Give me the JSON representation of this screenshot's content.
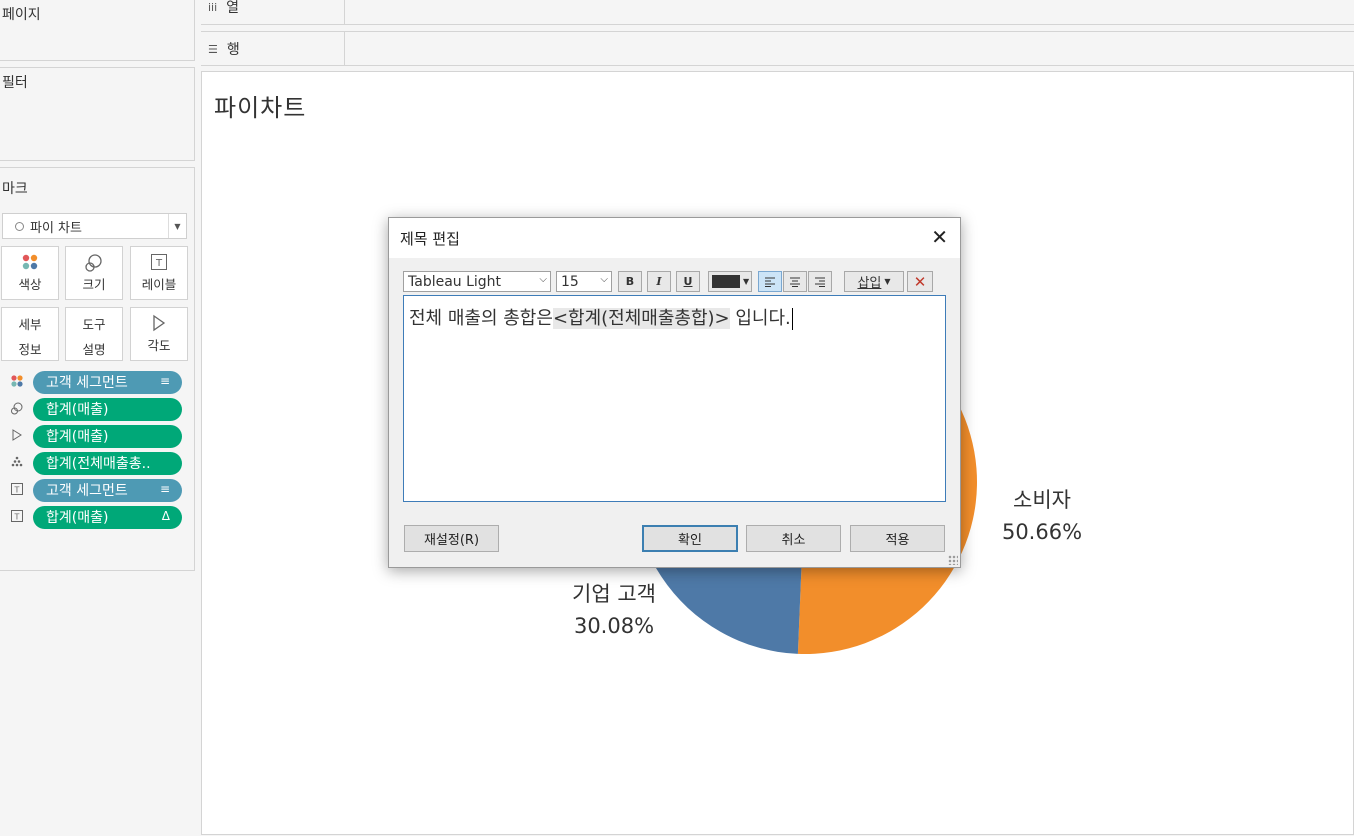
{
  "panels": {
    "pages": "페이지",
    "filters": "필터",
    "marks": "마크"
  },
  "mark_type": "파이 차트",
  "mark_buttons": {
    "color": "색상",
    "size": "크기",
    "label": "레이블",
    "detail_1": "세부",
    "detail_2": "정보",
    "tooltip_1": "도구",
    "tooltip_2": "설명",
    "angle": "각도"
  },
  "mark_pills": [
    {
      "icon": "color-dots-icon",
      "text": "고객 세그먼트",
      "color": "#4e9ab4"
    },
    {
      "icon": "size-icon",
      "text": "합계(매출)",
      "color": "#00a878"
    },
    {
      "icon": "angle-icon",
      "text": "합계(매출)",
      "color": "#00a878"
    },
    {
      "icon": "detail-icon",
      "text": "합계(전체매출총..",
      "color": "#00a878"
    },
    {
      "icon": "label-icon",
      "text": "고객 세그먼트",
      "color": "#4e9ab4"
    },
    {
      "icon": "label-icon",
      "text": "합계(매출)",
      "color": "#00a878"
    }
  ],
  "shelves": {
    "columns": "열",
    "rows": "행"
  },
  "sheet": {
    "title": "파이차트"
  },
  "chart_data": {
    "type": "pie",
    "slices": [
      {
        "category": "소비자",
        "percent_label": "50.66%",
        "value": 50.66,
        "color": "#f28e2b"
      },
      {
        "category": "기업 고객",
        "percent_label": "30.08%",
        "value": 30.08,
        "color": "#4e79a7"
      }
    ]
  },
  "dialog": {
    "title": "제목 편집",
    "font": "Tableau Light",
    "size": "15",
    "bold": "B",
    "italic": "I",
    "underline": "U",
    "insert": "삽입",
    "text_before": "전체 매출의 총합은",
    "text_field": "<합계(전체매출총합)>",
    "text_after": " 입니다.",
    "reset": "재설정(R)",
    "ok": "확인",
    "cancel": "취소",
    "apply": "적용",
    "text_color": "#333333"
  }
}
